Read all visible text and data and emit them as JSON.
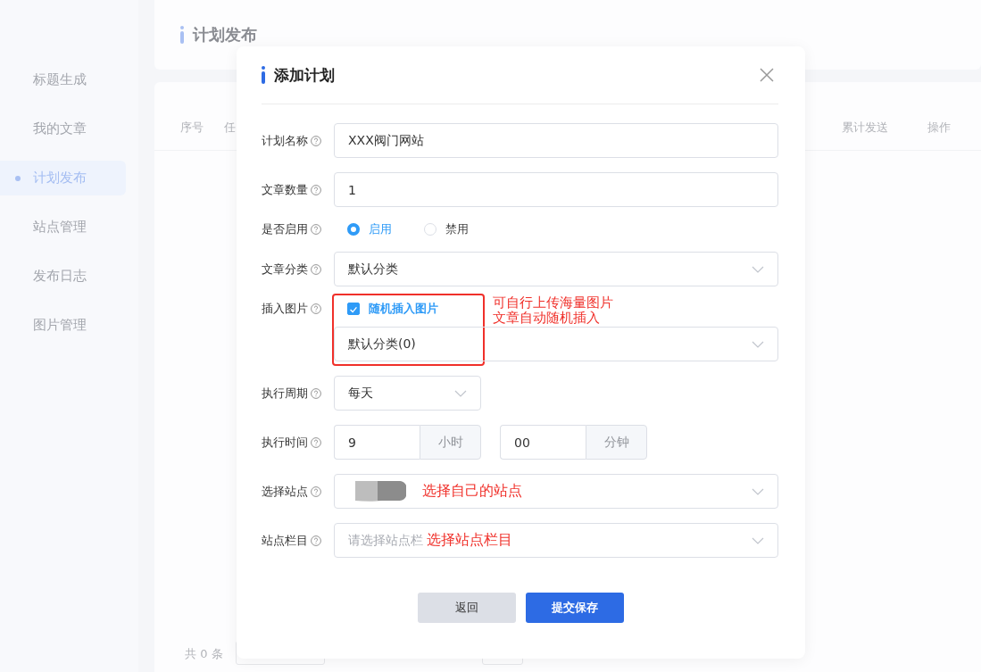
{
  "sidebar": {
    "items": [
      {
        "label": "标题生成",
        "selected": false
      },
      {
        "label": "我的文章",
        "selected": false
      },
      {
        "label": "计划发布",
        "selected": true
      },
      {
        "label": "站点管理",
        "selected": false
      },
      {
        "label": "发布日志",
        "selected": false
      },
      {
        "label": "图片管理",
        "selected": false
      }
    ]
  },
  "page": {
    "title": "计划发布"
  },
  "table": {
    "columns": [
      "序号",
      "任",
      "累计发送",
      "操作"
    ],
    "footer": "共 0 条"
  },
  "dialog": {
    "title": "添加计划",
    "fields": [
      {
        "kind": "text",
        "label": "计划名称",
        "value": "XXX阀门网站"
      },
      {
        "kind": "text",
        "label": "文章数量",
        "value": "1"
      },
      {
        "kind": "radio",
        "label": "是否启用",
        "options": [
          {
            "label": "启用",
            "selected": true
          },
          {
            "label": "禁用",
            "selected": false
          }
        ]
      },
      {
        "kind": "select",
        "label": "文章分类",
        "value": "默认分类"
      },
      {
        "kind": "image",
        "label": "插入图片",
        "checkbox": {
          "label": "随机插入图片",
          "checked": true
        },
        "value": "默认分类(0)",
        "annotation": {
          "kind": "boxed",
          "lines": [
            "可自行上传海量图片",
            "文章自动随机插入"
          ]
        }
      },
      {
        "kind": "short-select",
        "label": "执行周期",
        "value": "每天"
      },
      {
        "kind": "time",
        "label": "执行时间",
        "parts": [
          {
            "value": "9",
            "unit": "小时"
          },
          {
            "value": "00",
            "unit": "分钟"
          }
        ]
      },
      {
        "kind": "select",
        "label": "选择站点",
        "redacted": true,
        "annotation": {
          "kind": "inline",
          "lines": [
            "选择自己的站点"
          ]
        }
      },
      {
        "kind": "select",
        "label": "站点栏目",
        "placeholder": "请选择站点栏",
        "annotation": {
          "kind": "inline",
          "lines": [
            "选择站点栏目"
          ]
        }
      }
    ],
    "buttons": [
      {
        "label": "返回",
        "kind": "secondary"
      },
      {
        "label": "提交保存",
        "kind": "primary"
      }
    ]
  }
}
